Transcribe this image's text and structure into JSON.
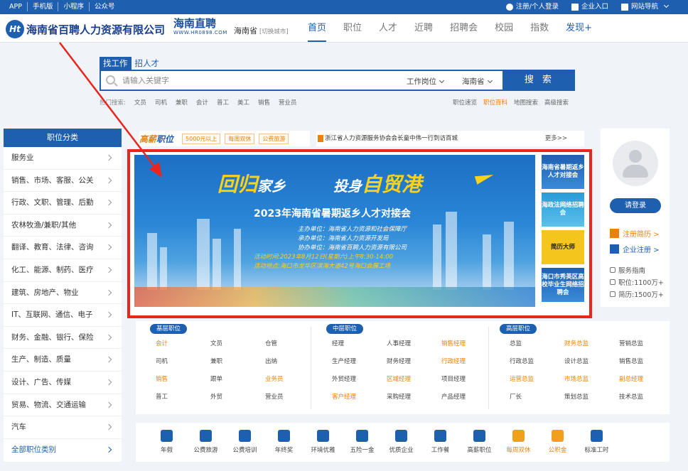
{
  "topbar": {
    "links": [
      "APP",
      "手机版",
      "小程序",
      "公众号"
    ],
    "register_login": "注册/个人登录",
    "enterprise_entry": "企业入口",
    "site_nav": "网站导航"
  },
  "header": {
    "logo_letters": "Ht",
    "company_name": "海南省百聘人力资源有限公司",
    "brand_cn": "海南直聘",
    "brand_url": "WWW.HR0898.COM",
    "city": "海南省",
    "city_switch": "[切换城市]",
    "nav": [
      "首页",
      "职位",
      "人才",
      "近聘",
      "招聘会",
      "校园",
      "指数",
      "发现+"
    ]
  },
  "search": {
    "tab_active": "找工作",
    "tab_other": "招人才",
    "placeholder": "请输入关键字",
    "select_type": "工作岗位",
    "select_region": "海南省",
    "button": "搜 索",
    "hot_label": "热门搜索:",
    "hot_terms": [
      "文员",
      "司机",
      "兼职",
      "会计",
      "普工",
      "美工",
      "销售",
      "营业员"
    ],
    "adv_links": [
      "职位速览",
      "职位百科",
      "地图搜索",
      "高级搜索"
    ]
  },
  "categories": {
    "title": "职位分类",
    "items": [
      "服务业",
      "销售、市场、客服、公关",
      "行政、文职、管理、后勤",
      "农林牧渔/兼职/其他",
      "翻译、教育、法律、咨询",
      "化工、能源、制药、医疗",
      "建筑、房地产、物业",
      "IT、互联网、通信、电子",
      "财务、金融、银行、保险",
      "生产、制造、质量",
      "设计、广告、传媒",
      "贸易、物流、交通运输",
      "汽车"
    ],
    "all": "全部职位类别"
  },
  "promo": {
    "brand_a": "高薪",
    "brand_b": "职位",
    "tags": [
      "5000元以上",
      "每周双休",
      "公费旅游"
    ]
  },
  "notice": {
    "text": "浙江省人力资源服务协会会长童中伟一行到访百城",
    "more": "更多>>"
  },
  "banner": {
    "slogan_a": "回归",
    "slogan_b": "家乡",
    "slogan_c": "投身",
    "slogan_d": "自贸港",
    "title": "2023年海南省暑期返乡人才对接会",
    "host": "主办单位：海南省人力资源和社会保障厅",
    "organizer": "承办单位：海南省人力资源开发局",
    "co_organizer": "协办单位：海南省百聘人力资源有限公司",
    "time": "活动时间:2023年8月12日(星期六)上午8:30-14:00",
    "place": "活动地点:海口市龙华区滨海大道42号海口会展工场",
    "side_ads": [
      "海南省暑期返乡人才对接会",
      "海政法网络招聘会",
      "简历大师",
      "海口市秀英区高校毕业生网络招聘会"
    ]
  },
  "user": {
    "login": "请登录",
    "register_resume": "注册简历 >",
    "register_company": "企业注册 >",
    "service_guide": "服务指南",
    "jobs_count": "职位:1100万+",
    "resume_count": "简历:1500万+"
  },
  "jobs": {
    "basic": {
      "label": "基层职位",
      "items": [
        "会计",
        "文员",
        "仓管",
        "司机",
        "兼职",
        "出纳",
        "销售",
        "跟单",
        "业务员",
        "普工",
        "外贸",
        "营业员"
      ],
      "highlight": [
        "会计",
        "销售",
        "业务员"
      ]
    },
    "middle": {
      "label": "中层职位",
      "items": [
        "经理",
        "人事经理",
        "销售经理",
        "生产经理",
        "财务经理",
        "行政经理",
        "外贸经理",
        "区域经理",
        "项目经理",
        "客户经理",
        "采购经理",
        "产品经理"
      ],
      "highlight": [
        "销售经理",
        "行政经理",
        "区域经理",
        "客户经理"
      ]
    },
    "senior": {
      "label": "高层职位",
      "items": [
        "总监",
        "财务总监",
        "营销总监",
        "行政总监",
        "设计总监",
        "销售总监",
        "运营总监",
        "市场总监",
        "副总经理",
        "厂长",
        "策划总监",
        "技术总监"
      ],
      "highlight": [
        "财务总监",
        "运营总监",
        "市场总监",
        "副总经理"
      ]
    }
  },
  "benefits": {
    "items": [
      "年假",
      "公费旅游",
      "公费培训",
      "年终奖",
      "环境优雅",
      "五险一金",
      "优质企业",
      "工作餐",
      "高薪职位",
      "每周双休",
      "公积金",
      "标准工时"
    ],
    "highlight": [
      "每周双休",
      "公积金"
    ]
  },
  "colors": {
    "primary": "#1f5fb0",
    "accent": "#e8820c",
    "annotation": "#e8261e"
  }
}
